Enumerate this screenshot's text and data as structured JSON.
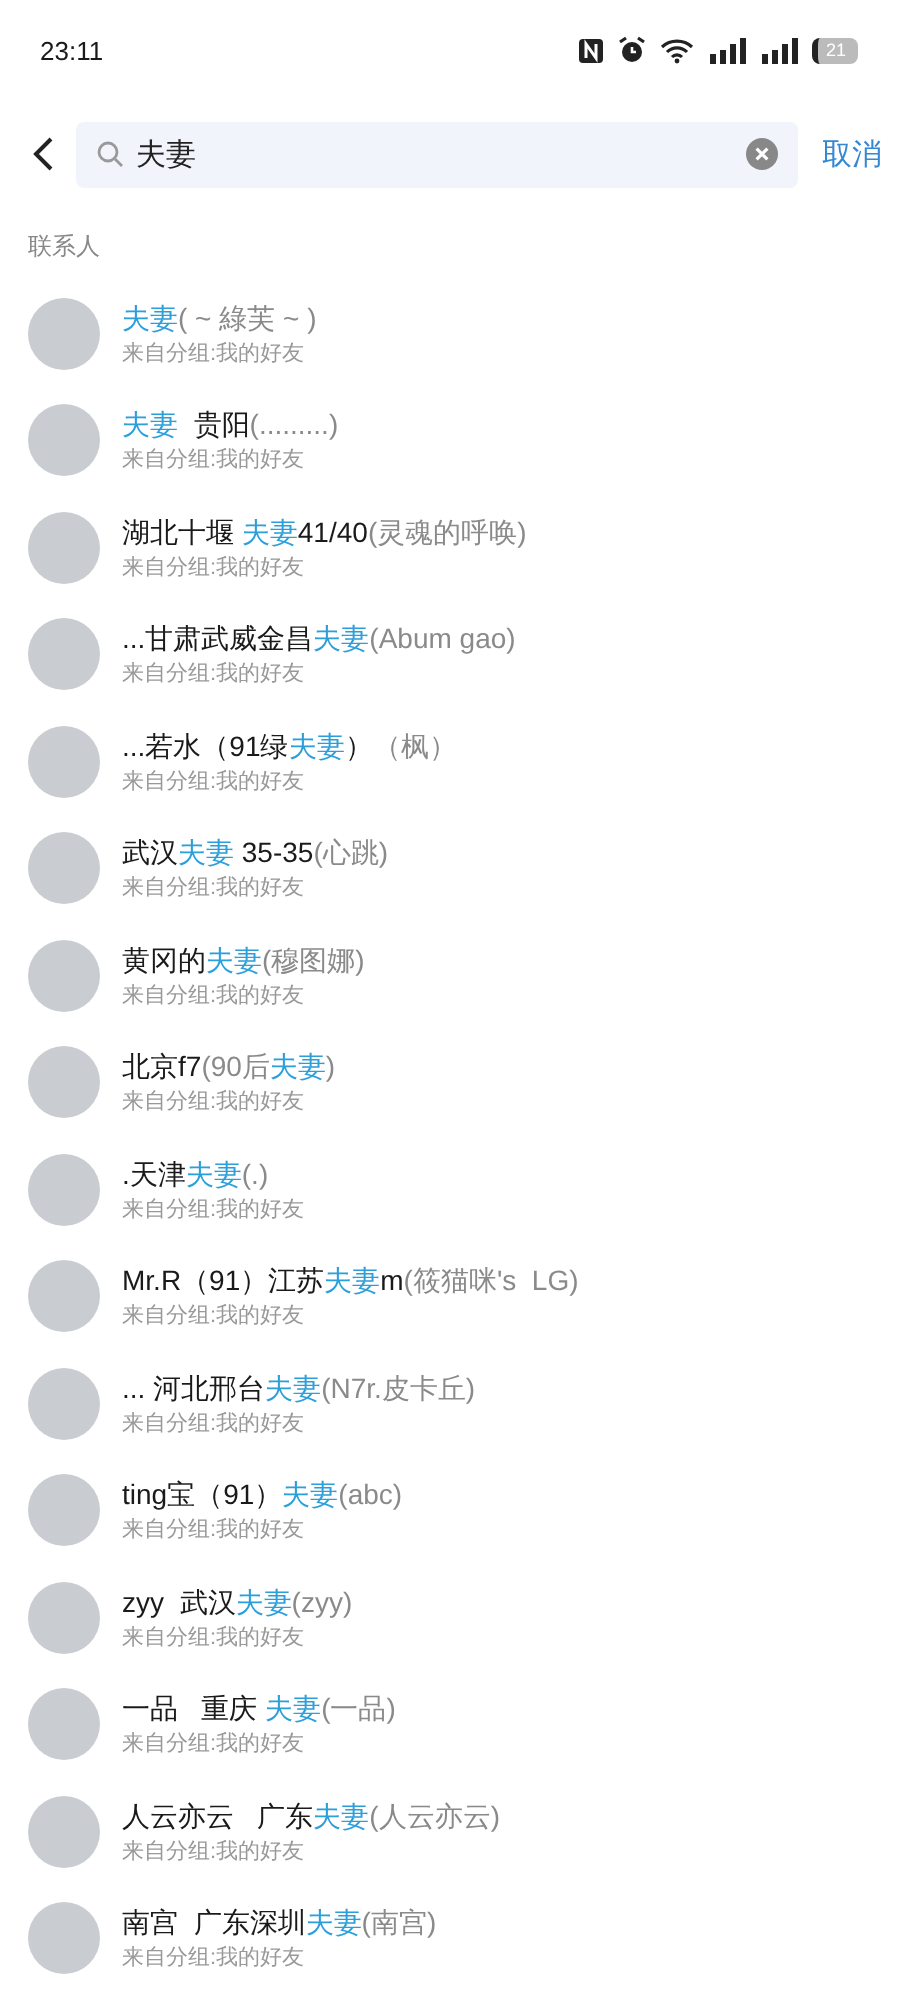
{
  "status_bar": {
    "time": "23:11",
    "battery": "21"
  },
  "search": {
    "value": "夫妻",
    "cancel": "取消"
  },
  "section_title": "联系人",
  "contacts": [
    {
      "name": [
        {
          "text": "夫妻",
          "kind": "match"
        },
        {
          "text": "( ~ 綠芙 ~ )",
          "kind": "note"
        }
      ],
      "group": "来自分组:我的好友"
    },
    {
      "name": [
        {
          "text": "夫妻",
          "kind": "match"
        },
        {
          "text": "  贵阳",
          "kind": "plain"
        },
        {
          "text": "(.........)",
          "kind": "note"
        }
      ],
      "group": "来自分组:我的好友"
    },
    {
      "name": [
        {
          "text": "湖北十堰 ",
          "kind": "plain"
        },
        {
          "text": "夫妻",
          "kind": "match"
        },
        {
          "text": "41/40",
          "kind": "plain"
        },
        {
          "text": "(灵魂的呼唤)",
          "kind": "note"
        }
      ],
      "group": "来自分组:我的好友"
    },
    {
      "name": [
        {
          "text": "...甘肃武威金昌",
          "kind": "plain"
        },
        {
          "text": "夫妻",
          "kind": "match"
        },
        {
          "text": "(Abum gao)",
          "kind": "note"
        }
      ],
      "group": "来自分组:我的好友"
    },
    {
      "name": [
        {
          "text": "...若水（91绿",
          "kind": "plain"
        },
        {
          "text": "夫妻",
          "kind": "match"
        },
        {
          "text": "）",
          "kind": "plain"
        },
        {
          "text": "（枫）",
          "kind": "note"
        }
      ],
      "group": "来自分组:我的好友"
    },
    {
      "name": [
        {
          "text": "武汉",
          "kind": "plain"
        },
        {
          "text": "夫妻",
          "kind": "match"
        },
        {
          "text": " 35-35",
          "kind": "plain"
        },
        {
          "text": "(心跳)",
          "kind": "note"
        }
      ],
      "group": "来自分组:我的好友"
    },
    {
      "name": [
        {
          "text": "黄冈的",
          "kind": "plain"
        },
        {
          "text": "夫妻",
          "kind": "match"
        },
        {
          "text": "(穆图娜)",
          "kind": "note"
        }
      ],
      "group": "来自分组:我的好友"
    },
    {
      "name": [
        {
          "text": "北京f7",
          "kind": "plain"
        },
        {
          "text": "(90后",
          "kind": "note"
        },
        {
          "text": "夫妻",
          "kind": "match"
        },
        {
          "text": ")",
          "kind": "note"
        }
      ],
      "group": "来自分组:我的好友"
    },
    {
      "name": [
        {
          "text": ".天津",
          "kind": "plain"
        },
        {
          "text": "夫妻",
          "kind": "match"
        },
        {
          "text": "(.)",
          "kind": "note"
        }
      ],
      "group": "来自分组:我的好友"
    },
    {
      "name": [
        {
          "text": "Mr.R（91）江苏",
          "kind": "plain"
        },
        {
          "text": "夫妻",
          "kind": "match"
        },
        {
          "text": "m",
          "kind": "plain"
        },
        {
          "text": "(筱猫咪's  LG)",
          "kind": "note"
        }
      ],
      "group": "来自分组:我的好友"
    },
    {
      "name": [
        {
          "text": "... 河北邢台",
          "kind": "plain"
        },
        {
          "text": "夫妻",
          "kind": "match"
        },
        {
          "text": "(N7r.皮卡丘)",
          "kind": "note"
        }
      ],
      "group": "来自分组:我的好友"
    },
    {
      "name": [
        {
          "text": "ting宝（91）",
          "kind": "plain"
        },
        {
          "text": "夫妻",
          "kind": "match"
        },
        {
          "text": "(abc)",
          "kind": "note"
        }
      ],
      "group": "来自分组:我的好友"
    },
    {
      "name": [
        {
          "text": "zyy  武汉",
          "kind": "plain"
        },
        {
          "text": "夫妻",
          "kind": "match"
        },
        {
          "text": "(zyy)",
          "kind": "note"
        }
      ],
      "group": "来自分组:我的好友"
    },
    {
      "name": [
        {
          "text": "一品   重庆 ",
          "kind": "plain"
        },
        {
          "text": "夫妻",
          "kind": "match"
        },
        {
          "text": "(一品)",
          "kind": "note"
        }
      ],
      "group": "来自分组:我的好友"
    },
    {
      "name": [
        {
          "text": "人云亦云   广东",
          "kind": "plain"
        },
        {
          "text": "夫妻",
          "kind": "match"
        },
        {
          "text": "(人云亦云)",
          "kind": "note"
        }
      ],
      "group": "来自分组:我的好友"
    },
    {
      "name": [
        {
          "text": "南宫  广东深圳",
          "kind": "plain"
        },
        {
          "text": "夫妻",
          "kind": "match"
        },
        {
          "text": "(南宫)",
          "kind": "note"
        }
      ],
      "group": "来自分组:我的好友"
    }
  ]
}
